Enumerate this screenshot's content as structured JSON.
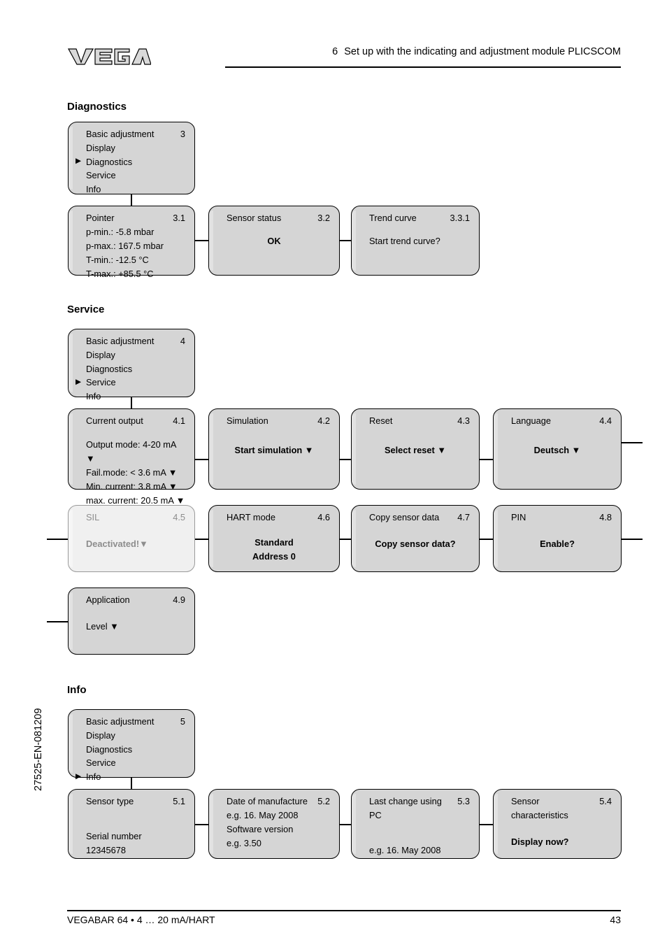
{
  "header": {
    "section_number": "6",
    "title": "Set up with the indicating and adjustment module PLICSCOM",
    "logo_text": "VEGA"
  },
  "footer": {
    "product": "VEGABAR 64 • 4 … 20 mA/HART",
    "page": "43",
    "doc_code": "27525-EN-081209"
  },
  "sections": {
    "diagnostics": {
      "heading": "Diagnostics"
    },
    "service": {
      "heading": "Service"
    },
    "info": {
      "heading": "Info"
    }
  },
  "menus": {
    "diagnostics": {
      "number": "3",
      "items": [
        "Basic adjustment",
        "Display",
        "Diagnostics",
        "Service",
        "Info"
      ],
      "selected": "Diagnostics"
    },
    "service": {
      "number": "4",
      "items": [
        "Basic adjustment",
        "Display",
        "Diagnostics",
        "Service",
        "Info"
      ],
      "selected": "Service"
    },
    "info": {
      "number": "5",
      "items": [
        "Basic adjustment",
        "Display",
        "Diagnostics",
        "Service",
        "Info"
      ],
      "selected": "Info"
    }
  },
  "screens": {
    "pointer": {
      "title": "Pointer",
      "number": "3.1",
      "lines": [
        "p-min.: -5.8 mbar",
        "p-max.: 167.5 mbar",
        "T-min.: -12.5 °C",
        "T-max.: +85.5 °C"
      ]
    },
    "sensor_status": {
      "title": "Sensor status",
      "number": "3.2",
      "value": "OK"
    },
    "trend_curve": {
      "title": "Trend curve",
      "number": "3.3.1",
      "value": "Start trend curve?"
    },
    "current_output": {
      "title": "Current output",
      "number": "4.1",
      "lines": [
        "Output mode: 4-20 mA ▼",
        "Fail.mode: < 3.6 mA ▼",
        "Min. current: 3.8 mA ▼",
        "max. current: 20.5 mA ▼"
      ]
    },
    "simulation": {
      "title": "Simulation",
      "number": "4.2",
      "value": "Start simulation ▼"
    },
    "reset": {
      "title": "Reset",
      "number": "4.3",
      "value": "Select reset ▼"
    },
    "language": {
      "title": "Language",
      "number": "4.4",
      "value": "Deutsch ▼"
    },
    "sil": {
      "title": "SIL",
      "number": "4.5",
      "value": "Deactivated!▼",
      "state": "disabled"
    },
    "hart_mode": {
      "title": "HART mode",
      "number": "4.6",
      "value_line1": "Standard",
      "value_line2": "Address 0"
    },
    "copy_sensor_data": {
      "title": "Copy sensor data",
      "number": "4.7",
      "value": "Copy sensor data?"
    },
    "pin": {
      "title": "PIN",
      "number": "4.8",
      "value": "Enable?"
    },
    "application": {
      "title": "Application",
      "number": "4.9",
      "value": "Level ▼"
    },
    "sensor_type": {
      "title": "Sensor type",
      "number": "5.1",
      "line_label": "Serial number",
      "line_value": "12345678"
    },
    "date_of_manufacture": {
      "title": "Date of manufacture",
      "number": "5.2",
      "lines": [
        "e.g. 16. May 2008",
        "Software version",
        "e.g. 3.50"
      ]
    },
    "last_change_pc": {
      "title": "Last change using PC",
      "number": "5.3",
      "value": "e.g. 16. May 2008"
    },
    "sensor_characteristics": {
      "title": "Sensor characteristics",
      "number": "5.4",
      "value": "Display now?"
    }
  }
}
